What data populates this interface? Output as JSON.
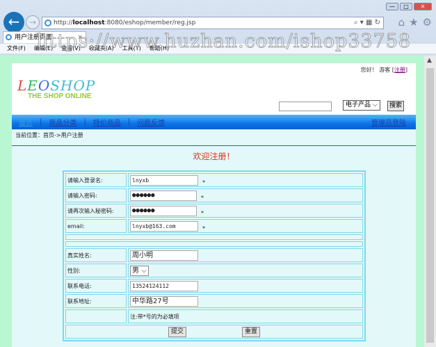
{
  "browser": {
    "url_prefix": "http://",
    "url_host": "localhost",
    "url_rest": ":8080/eshop/member/reg.jsp",
    "tab_title": "用户注册页面",
    "tab_close": "×",
    "menu": [
      "文件(F)",
      "编辑(E)",
      "查看(V)",
      "收藏夹(A)",
      "工具(T)",
      "帮助(H)"
    ],
    "watermark": "https://www.huzhan.com/ishop33758"
  },
  "header": {
    "greeting": "您好！ 游客 [",
    "register_link": "注册",
    "greeting_end": "]",
    "logo_top": "LEOSHOP",
    "logo_sub": "THE SHOP ONLINE",
    "search_value": "",
    "category": "电子产品",
    "search_button": "搜索"
  },
  "nav": {
    "items": [
      "首页",
      "商品分类",
      "特价商品",
      "问题反馈"
    ],
    "separator": "|",
    "admin": "管理员登陆"
  },
  "breadcrumb": "当前位置：首页->用户注册",
  "title": "欢迎注册！",
  "form": {
    "username_label": "请输入登录名:",
    "username": "lnyxb",
    "password_label": "请输入密码:",
    "password": "●●●●●●",
    "password2_label": "请再次输入秘密码:",
    "password2": "●●●●●●",
    "email_label": "email:",
    "email": "lnyxb@163.com",
    "required_mark": "*",
    "realname_label": "真实姓名:",
    "realname": "周小明",
    "gender_label": "性别:",
    "gender": "男",
    "phone_label": "联系电话:",
    "phone": "13524124112",
    "address_label": "联系地址:",
    "address": "中华路27号",
    "note": "注:带*号的为必填项",
    "submit": "提交",
    "reset": "重置"
  }
}
